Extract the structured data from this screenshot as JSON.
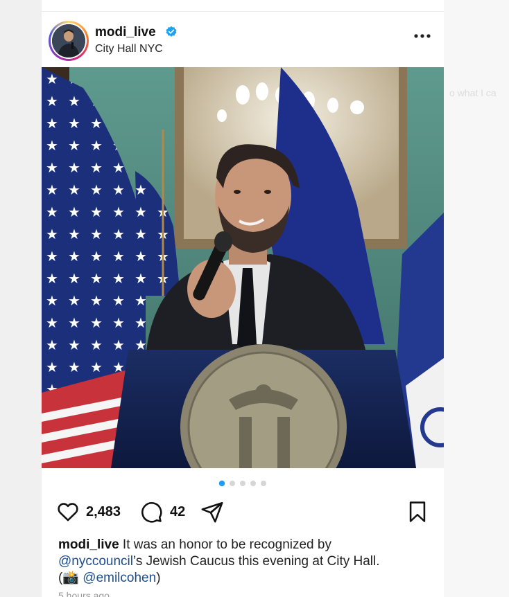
{
  "post": {
    "username": "modi_live",
    "location": "City Hall NYC",
    "likes": "2,483",
    "comments": "42",
    "carousel_total": 5,
    "carousel_active": 1,
    "caption": {
      "user": "modi_live",
      "text1": " It was an honor to be recognized by ",
      "mention1": "@nyccouncil",
      "text2": "’s Jewish Caucus this evening at City Hall.",
      "open_paren": "(",
      "camera_emoji": "📸",
      "mention2": "@emilcohen",
      "close_paren": ")"
    },
    "time": "5 hours ago"
  },
  "background": {
    "partial_text": "o what I ca"
  },
  "colors": {
    "accent": "#1da1f2",
    "dot_active": "#1f9bf0",
    "dot_inactive": "#d6d6d6"
  },
  "icons": [
    "verified-badge-icon",
    "more-icon",
    "heart-icon",
    "comment-icon",
    "share-icon",
    "bookmark-icon",
    "camera-icon"
  ]
}
